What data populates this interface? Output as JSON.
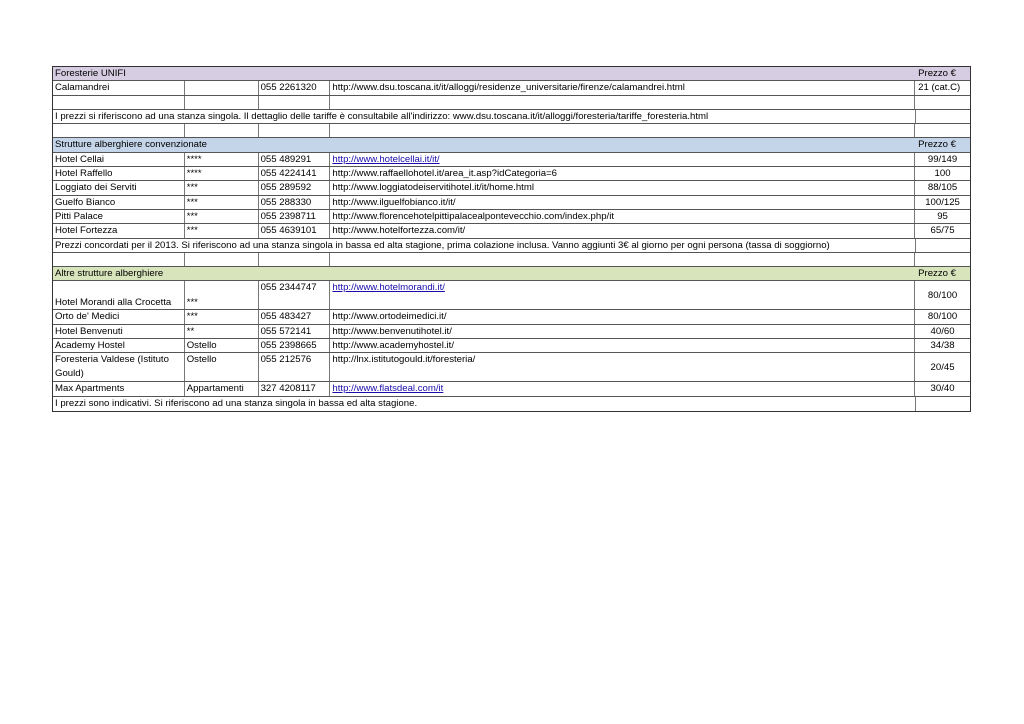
{
  "sections": {
    "unifi": {
      "title": "Foresterie UNIFI",
      "price_label": "Prezzo €",
      "rows": [
        {
          "name": "Calamandrei",
          "category": "",
          "phone": "055 2261320",
          "url": "http://www.dsu.toscana.it/it/alloggi/residenze_universitarie/firenze/calamandrei.html",
          "price": "21 (cat.C)"
        }
      ],
      "note": "I prezzi si riferiscono ad una stanza singola. Il dettaglio delle tariffe è consultabile all'indirizzo: www.dsu.toscana.it/it/alloggi/foresteria/tariffe_foresteria.html"
    },
    "convenzionate": {
      "title": "Strutture alberghiere convenzionate",
      "price_label": "Prezzo €",
      "rows": [
        {
          "name": "Hotel Cellai",
          "category": "****",
          "phone": "055 489291",
          "url": "http://www.hotelcellai.it/it/",
          "price": "99/149"
        },
        {
          "name": "Hotel Raffello",
          "category": "****",
          "phone": "055 4224141",
          "url": "http://www.raffaellohotel.it/area_it.asp?idCategoria=6",
          "price": "100"
        },
        {
          "name": "Loggiato dei Serviti",
          "category": "***",
          "phone": "055 289592",
          "url": "http://www.loggiatodeiservitihotel.it/it/home.html",
          "price": "88/105"
        },
        {
          "name": "Guelfo Bianco",
          "category": "***",
          "phone": "055 288330",
          "url": "http://www.ilguelfobianco.it/it/",
          "price": "100/125"
        },
        {
          "name": "Pitti Palace",
          "category": "***",
          "phone": "055 2398711",
          "url": "http://www.florencehotelpittipalacealpontevecchio.com/index.php/it",
          "price": "95"
        },
        {
          "name": "Hotel Fortezza",
          "category": "***",
          "phone": "055 4639101",
          "url": "http://www.hotelfortezza.com/it/",
          "price": "65/75"
        }
      ],
      "note": "Prezzi concordati per il 2013. Si riferiscono ad una stanza singola in bassa ed alta stagione, prima colazione inclusa. Vanno aggiunti 3€ al giorno per ogni persona (tassa di soggiorno)"
    },
    "altre": {
      "title": "Altre strutture alberghiere",
      "price_label": "Prezzo €",
      "rows": [
        {
          "name": "Hotel Morandi alla Crocetta",
          "category": "***",
          "phone": "055 2344747",
          "url": "http://www.hotelmorandi.it/",
          "price": "80/100"
        },
        {
          "name": "Orto de' Medici",
          "category": "***",
          "phone": "055 483427",
          "url": "http://www.ortodeimedici.it/",
          "price": "80/100"
        },
        {
          "name": "Hotel Benvenuti",
          "category": "**",
          "phone": "055 572141",
          "url": "http://www.benvenutihotel.it/",
          "price": "40/60"
        },
        {
          "name": "Academy Hostel",
          "category": "Ostello",
          "phone": "055 2398665",
          "url": "http://www.academyhostel.it/",
          "price": "34/38"
        },
        {
          "name": "Foresteria Valdese (Istituto Gould)",
          "category": "Ostello",
          "phone": "055 212576",
          "url": "http://lnx.istitutogould.it/foresteria/",
          "price": "20/45"
        },
        {
          "name": "Max Apartments",
          "category": "Appartamenti",
          "phone": "327 4208117",
          "url": "http://www.flatsdeal.com/it",
          "price": "30/40"
        }
      ],
      "note": "I prezzi sono indicativi. Si riferiscono ad una stanza singola in bassa ed alta stagione."
    }
  },
  "colors": {
    "header_unifi": "#d6cde2",
    "header_convenzionate": "#c4d5e9",
    "header_altre": "#d8e4bc",
    "link": "#1a0dab"
  }
}
